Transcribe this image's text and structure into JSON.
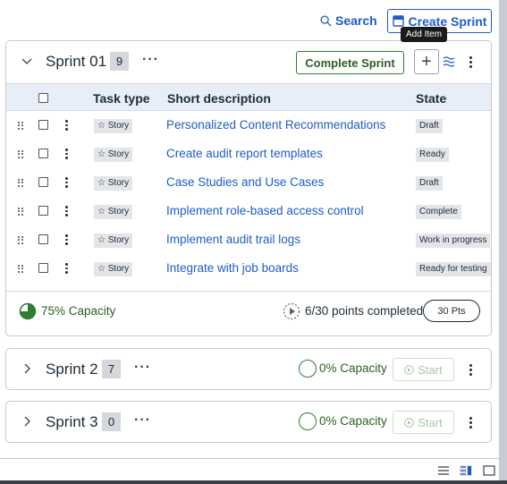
{
  "toolbar": {
    "search_label": "Search",
    "create_sprint_label": "Create Sprint",
    "tooltip": "Add Item"
  },
  "colors": {
    "accent": "#1f5cc6",
    "success": "#2e7d32",
    "header_bg": "#e8eef7"
  },
  "sprint1": {
    "name": "Sprint 01",
    "count": "9",
    "more": "···",
    "complete_label": "Complete Sprint",
    "columns": {
      "type": "Task type",
      "desc": "Short description",
      "state": "State"
    },
    "rows": [
      {
        "type": "☆ Story",
        "desc": "Personalized Content Recommendations",
        "state": "Draft"
      },
      {
        "type": "☆ Story",
        "desc": "Create audit report templates",
        "state": "Ready"
      },
      {
        "type": "☆ Story",
        "desc": "Case Studies and Use Cases",
        "state": "Draft"
      },
      {
        "type": "☆ Story",
        "desc": "Implement role-based access control",
        "state": "Complete"
      },
      {
        "type": "☆ Story",
        "desc": "Implement audit trail logs",
        "state": "Work in progress"
      },
      {
        "type": "☆ Story",
        "desc": "Integrate with job boards",
        "state": "Ready for testing"
      }
    ],
    "capacity": "75% Capacity",
    "capacity_fraction": 0.75,
    "points_completed": "6/30 points completed",
    "points_pill": "30 Pts"
  },
  "sprint2": {
    "name": "Sprint 2",
    "count": "7",
    "more": "···",
    "capacity": "0% Capacity",
    "start_label": "Start"
  },
  "sprint3": {
    "name": "Sprint 3",
    "count": "0",
    "more": "···",
    "capacity": "0% Capacity",
    "start_label": "Start"
  }
}
